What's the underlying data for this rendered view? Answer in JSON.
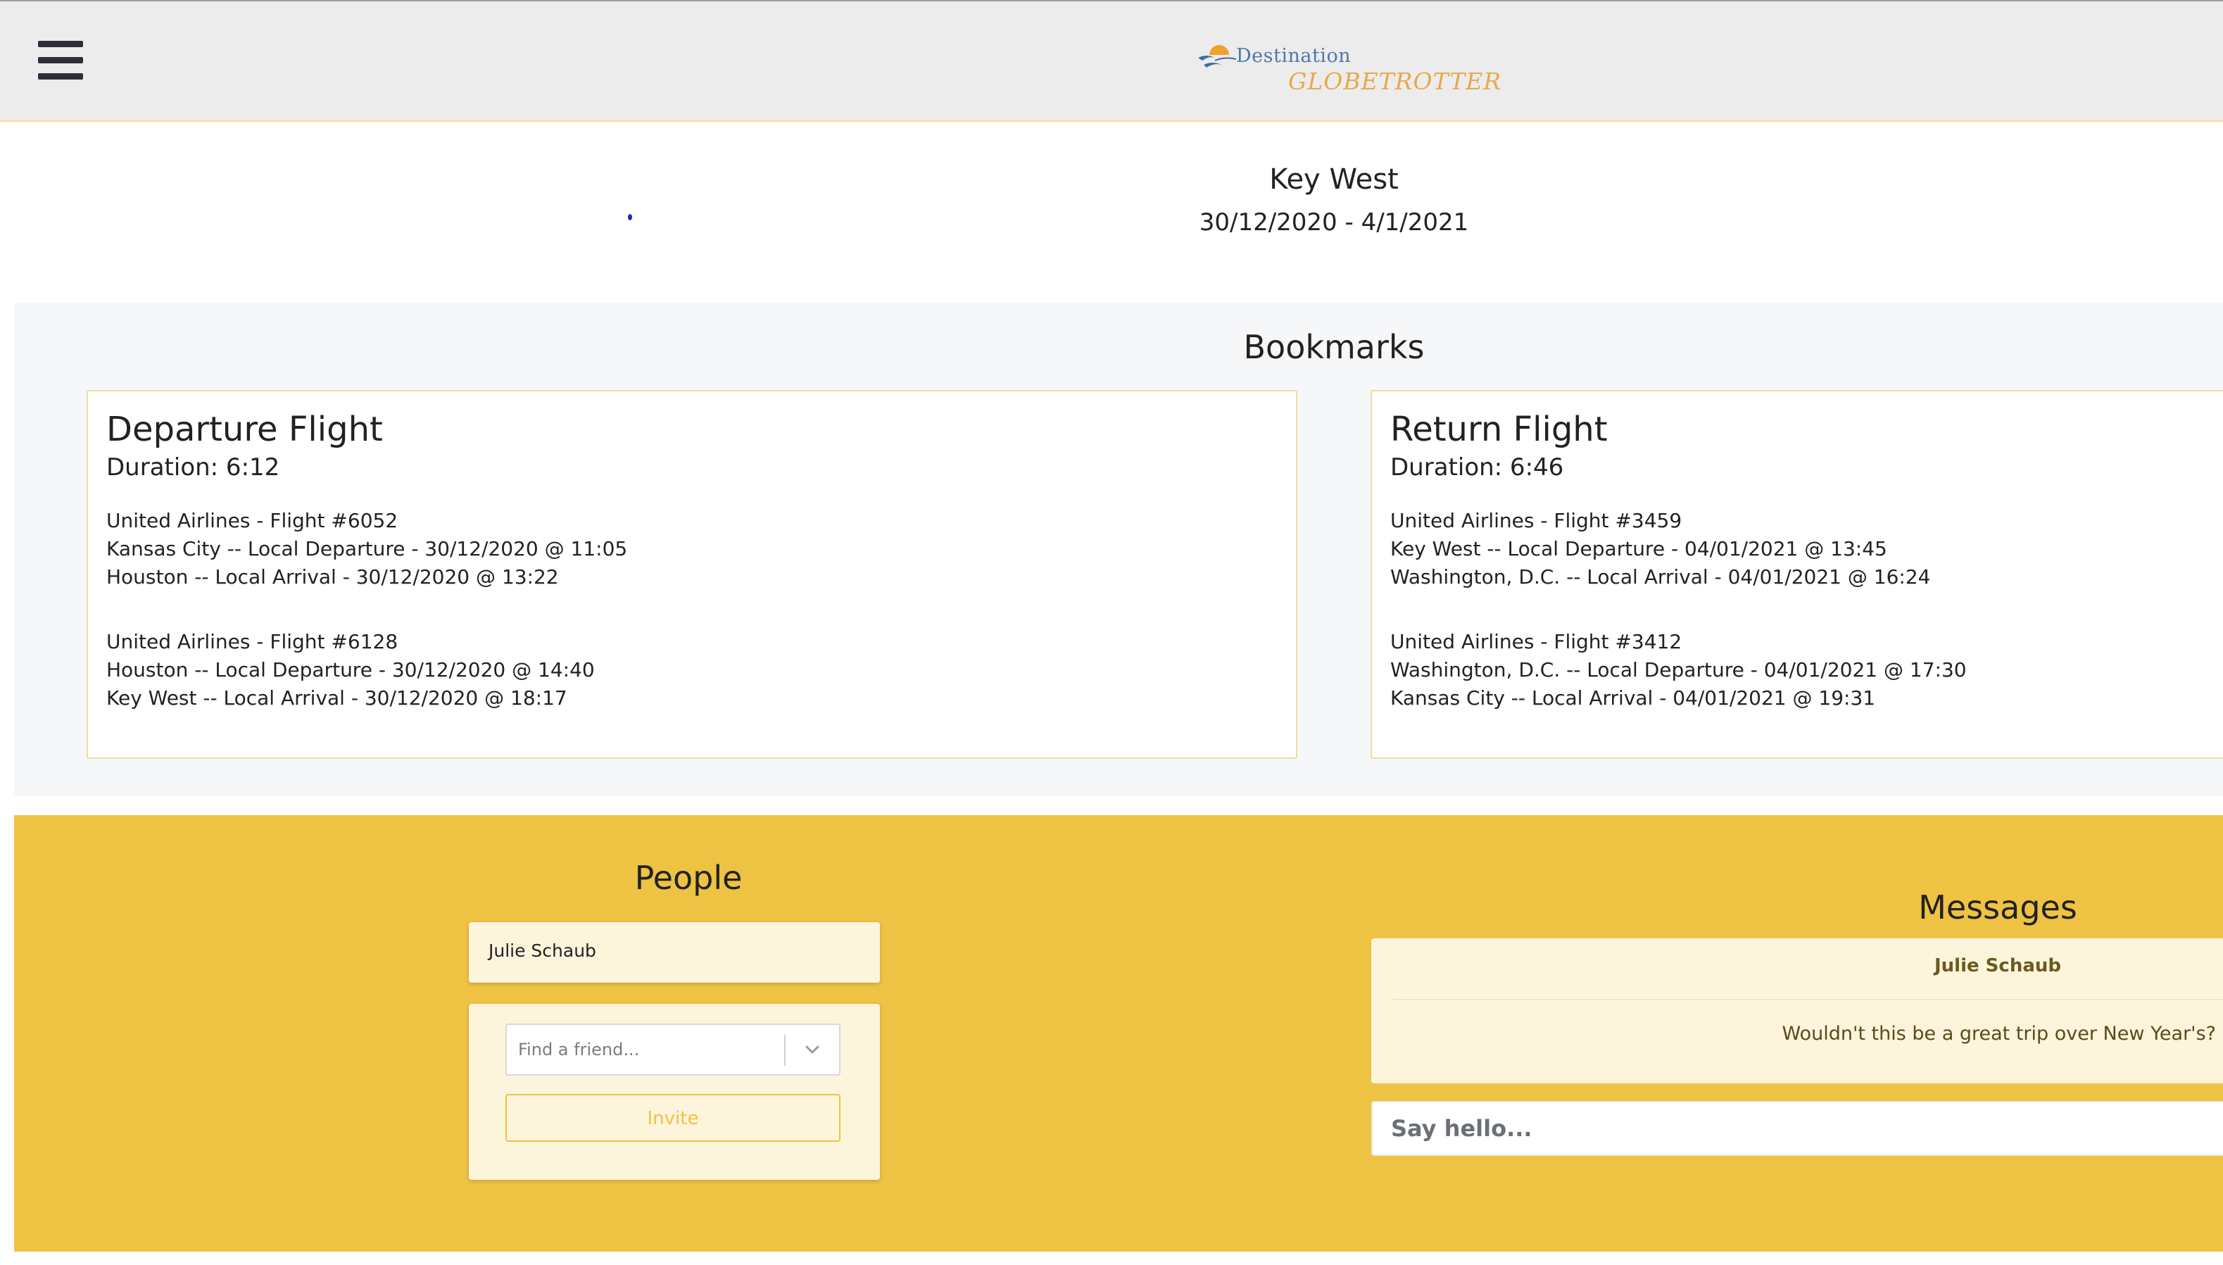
{
  "header": {
    "menu_icon": "hamburger-menu-icon",
    "logo": {
      "word1": "Destination",
      "word2": "GLOBETROTTER",
      "colors": {
        "blue": "#4c79a8",
        "orange": "#e8a94b"
      }
    }
  },
  "trip": {
    "title": "Key West",
    "dates": "30/12/2020 - 4/1/2021"
  },
  "bookmarks": {
    "title": "Bookmarks",
    "departure": {
      "title": "Departure Flight",
      "duration": "Duration: 6:12",
      "segments": [
        {
          "flight": "United Airlines - Flight #6052",
          "departure": "Kansas City -- Local Departure - 30/12/2020 @ 11:05",
          "arrival": "Houston -- Local Arrival - 30/12/2020 @ 13:22"
        },
        {
          "flight": "United Airlines - Flight #6128",
          "departure": "Houston -- Local Departure - 30/12/2020 @ 14:40",
          "arrival": "Key West -- Local Arrival - 30/12/2020 @ 18:17"
        }
      ]
    },
    "return": {
      "title": "Return Flight",
      "duration": "Duration: 6:46",
      "segments": [
        {
          "flight": "United Airlines - Flight #3459",
          "departure": "Key West -- Local Departure - 04/01/2021 @ 13:45",
          "arrival": "Washington, D.C. -- Local Arrival - 04/01/2021 @ 16:24"
        },
        {
          "flight": "United Airlines - Flight #3412",
          "departure": "Washington, D.C. -- Local Departure - 04/01/2021 @ 17:30",
          "arrival": "Kansas City -- Local Arrival - 04/01/2021 @ 19:31"
        }
      ]
    }
  },
  "people": {
    "title": "People",
    "members": [
      "Julie Schaub"
    ],
    "find_placeholder": "Find a friend...",
    "invite_label": "Invite"
  },
  "messages": {
    "title": "Messages",
    "items": [
      {
        "author": "Julie Schaub",
        "text": "Wouldn't this be a great trip over New Year's?"
      }
    ],
    "input_placeholder": "Say hello..."
  },
  "colors": {
    "accent_yellow": "#eec243",
    "card_cream": "#fdf4dc",
    "header_bg": "#ececec"
  }
}
